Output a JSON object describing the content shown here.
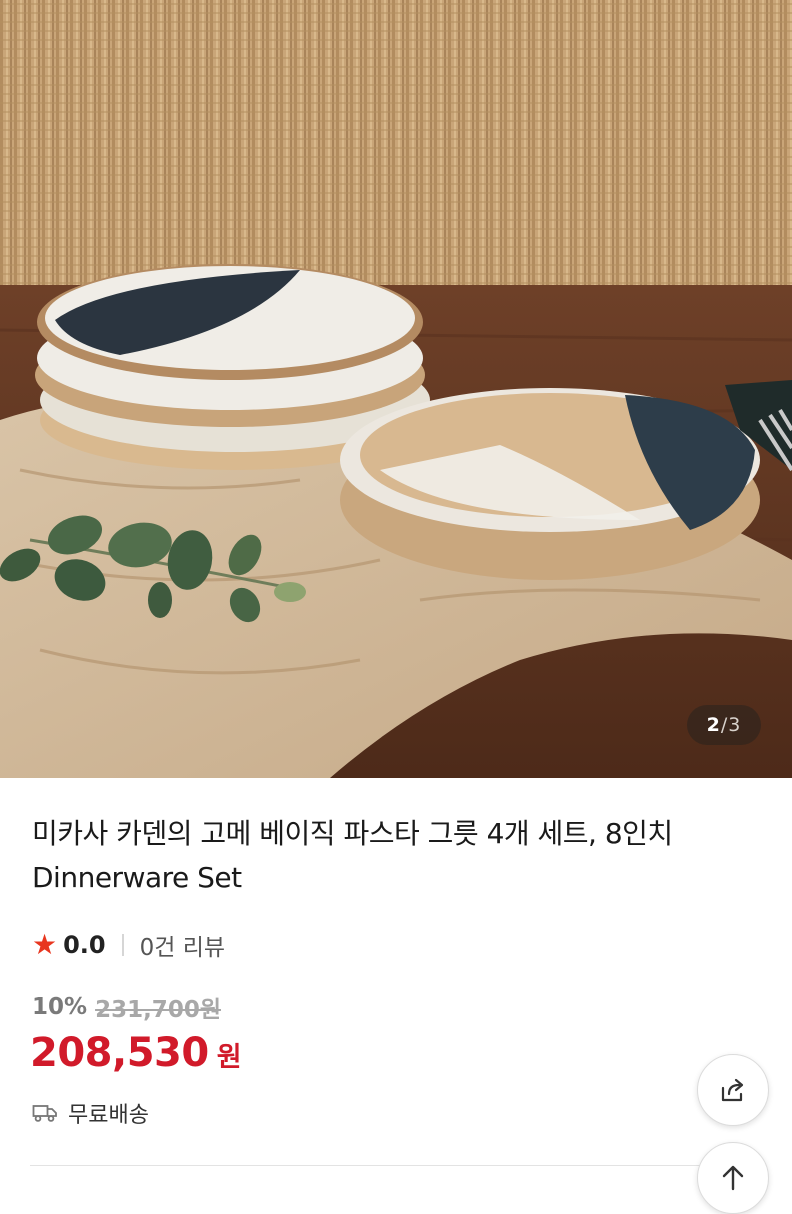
{
  "gallery": {
    "current_page": "2",
    "separator": "/",
    "total_pages": "3"
  },
  "product": {
    "title": "미카사 카덴의 고메 베이직 파스타 그릇 4개 세트, 8인치 Dinnerware Set",
    "rating": {
      "score": "0.0",
      "review_text": "0건 리뷰",
      "star_color": "#e8361f"
    },
    "price": {
      "discount": "10%",
      "original": "231,700원",
      "sale_amount": "208,530",
      "sale_unit": "원",
      "sale_color": "#d11a2a"
    },
    "shipping": {
      "label": "무료배송",
      "icon": "truck-icon"
    }
  },
  "actions": {
    "share_icon": "share-icon",
    "scroll_top_icon": "arrow-up-icon"
  }
}
